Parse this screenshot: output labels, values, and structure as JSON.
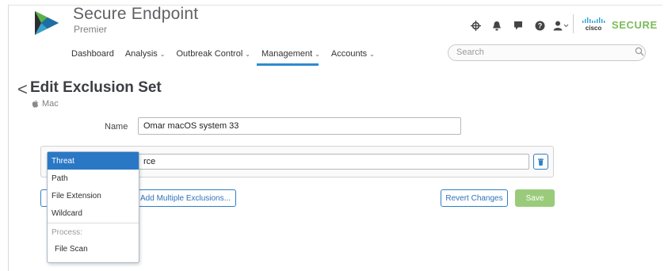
{
  "brand": {
    "title": "Secure Endpoint",
    "subtitle": "Premier",
    "vendor_wordmark": "cisco",
    "product_word": "SECURE"
  },
  "header_icons": [
    "crosshair-icon",
    "bell-icon",
    "chat-icon",
    "help-icon",
    "user-icon"
  ],
  "nav": {
    "items": [
      {
        "label": "Dashboard",
        "has_caret": false
      },
      {
        "label": "Analysis",
        "has_caret": true
      },
      {
        "label": "Outbreak Control",
        "has_caret": true
      },
      {
        "label": "Management",
        "has_caret": true,
        "active": true
      },
      {
        "label": "Accounts",
        "has_caret": true
      }
    ],
    "caret": "⌄",
    "active_color": "#2e8bd0"
  },
  "search": {
    "placeholder": "Search"
  },
  "page": {
    "back": "<",
    "title": "Edit Exclusion Set",
    "os": "Mac"
  },
  "form": {
    "name_label": "Name",
    "name_value": "Omar macOS system 33",
    "exclusion_value_visible": "rce"
  },
  "buttons": {
    "add_multiple": "Add Multiple Exclusions...",
    "revert": "Revert Changes",
    "save": "Save"
  },
  "dropdown": {
    "options": [
      "Threat",
      "Path",
      "File Extension",
      "Wildcard"
    ],
    "selected": "Threat",
    "group_label": "Process:",
    "group_options": [
      "File Scan"
    ]
  },
  "colors": {
    "accent_blue": "#2a78c5",
    "save_green": "#9acb7b",
    "secure_green": "#7bbb59"
  }
}
